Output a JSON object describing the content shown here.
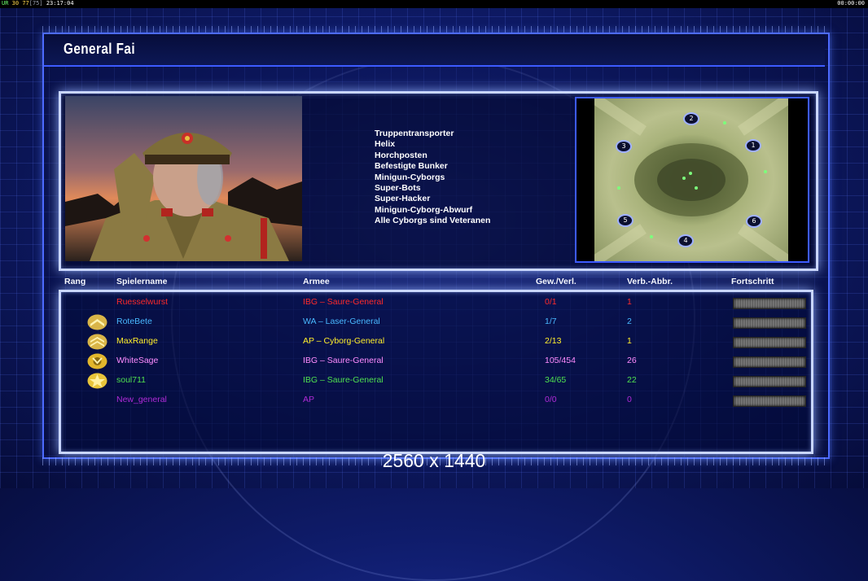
{
  "topbar": {
    "left": {
      "a": "UR",
      "b": "30",
      "c": "77",
      "d": "[75]",
      "time": "23:17:04"
    },
    "right_time": "00:00:00"
  },
  "general": {
    "title": "General Fai"
  },
  "units": [
    "Truppentransporter",
    "Helix",
    "Horchposten",
    "Befestigte Bunker",
    "Minigun-Cyborgs",
    "Super-Bots",
    "Super-Hacker",
    "Minigun-Cyborg-Abwurf",
    "Alle Cyborgs sind Veteranen"
  ],
  "map": {
    "spawns": [
      "1",
      "2",
      "3",
      "4",
      "5",
      "6"
    ]
  },
  "table": {
    "headers": {
      "rank": "Rang",
      "player": "Spielername",
      "army": "Armee",
      "winloss": "Gew./Verl.",
      "disconnect": "Verb.-Abbr.",
      "progress": "Fortschritt"
    },
    "rows": [
      {
        "name": "Ruesselwurst",
        "army": "IBG – Saure-General",
        "winloss": "0/1",
        "disc": "1",
        "color": "#ff2a2a",
        "rank": "none",
        "progress": 1.0
      },
      {
        "name": "RoteBete",
        "army": "WA – Laser-General",
        "winloss": "1/7",
        "disc": "2",
        "color": "#49b8ff",
        "rank": "chevron-1",
        "progress": 1.0
      },
      {
        "name": "MaxRange",
        "army": "AP – Cyborg-General",
        "winloss": "2/13",
        "disc": "1",
        "color": "#ffee2a",
        "rank": "chevron-2",
        "progress": 1.0
      },
      {
        "name": "WhiteSage",
        "army": "IBG – Saure-General",
        "winloss": "105/454",
        "disc": "26",
        "color": "#ff8cff",
        "rank": "emblem-1",
        "progress": 1.0
      },
      {
        "name": "soul711",
        "army": "IBG – Saure-General",
        "winloss": "34/65",
        "disc": "22",
        "color": "#4fe04f",
        "rank": "emblem-2",
        "progress": 1.0
      },
      {
        "name": "New_general",
        "army": "AP",
        "winloss": "0/0",
        "disc": "0",
        "color": "#b02bd8",
        "rank": "none",
        "progress": 1.0
      }
    ]
  },
  "resolution_label": "2560 x 1440"
}
